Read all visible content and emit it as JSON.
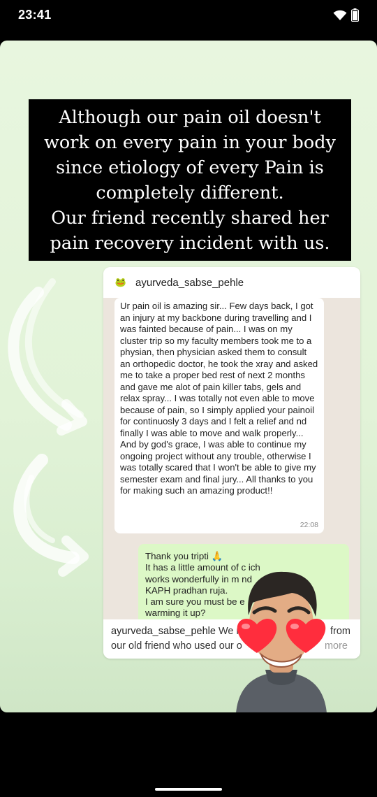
{
  "status": {
    "time": "23:41",
    "wifi_icon": "wifi-icon",
    "battery_icon": "battery-icon"
  },
  "story": {
    "caption_lines": [
      "Although our pain oil doesn't",
      "work on every pain in your body",
      "since etiology of every Pain is",
      "completely different.",
      "Our friend recently shared her",
      "pain recovery incident with us."
    ],
    "post": {
      "username": "ayurveda_sabse_pehle",
      "avatar_icon": "brand-logo-icon",
      "incoming_message": {
        "text": "Ur pain oil is amazing sir... Few days back, I got an injury at my backbone during travelling and I was fainted because of pain... I was on my cluster trip so my faculty members took me to a physian, then physician asked them to consult an orthopedic doctor, he took the xray and asked me to take a proper bed rest of next 2 months and gave me alot of pain killer tabs, gels and relax spray... I was totally not even able to move because of pain, so I simply applied your painoil for continuosly 3 days and I felt a relief and nd finally I was able to move and walk properly... And by god's grace, I was able to continue my ongoing project without any trouble, otherwise I was totally scared that I won't be able to give my semester exam and final jury... All thanks to you for making such an amazing product!!",
        "time": "22:08"
      },
      "outgoing_message": {
        "text": "Thank you tripti 🙏\nIt has a little amount of c          ich\nworks wonderfully in m            nd\nKAPH pradhan ruja.\nI am sure you must be            e\nwarming it up?",
        "ticks_icon": "double-check-icon"
      },
      "caption": {
        "username": "ayurveda_sabse_pehle",
        "text_start": " We r",
        "text_end": "from",
        "line2": "our old friend who used our o",
        "more": "more"
      }
    },
    "sticker": {
      "icon": "heart-eyes-avatar-icon"
    }
  }
}
